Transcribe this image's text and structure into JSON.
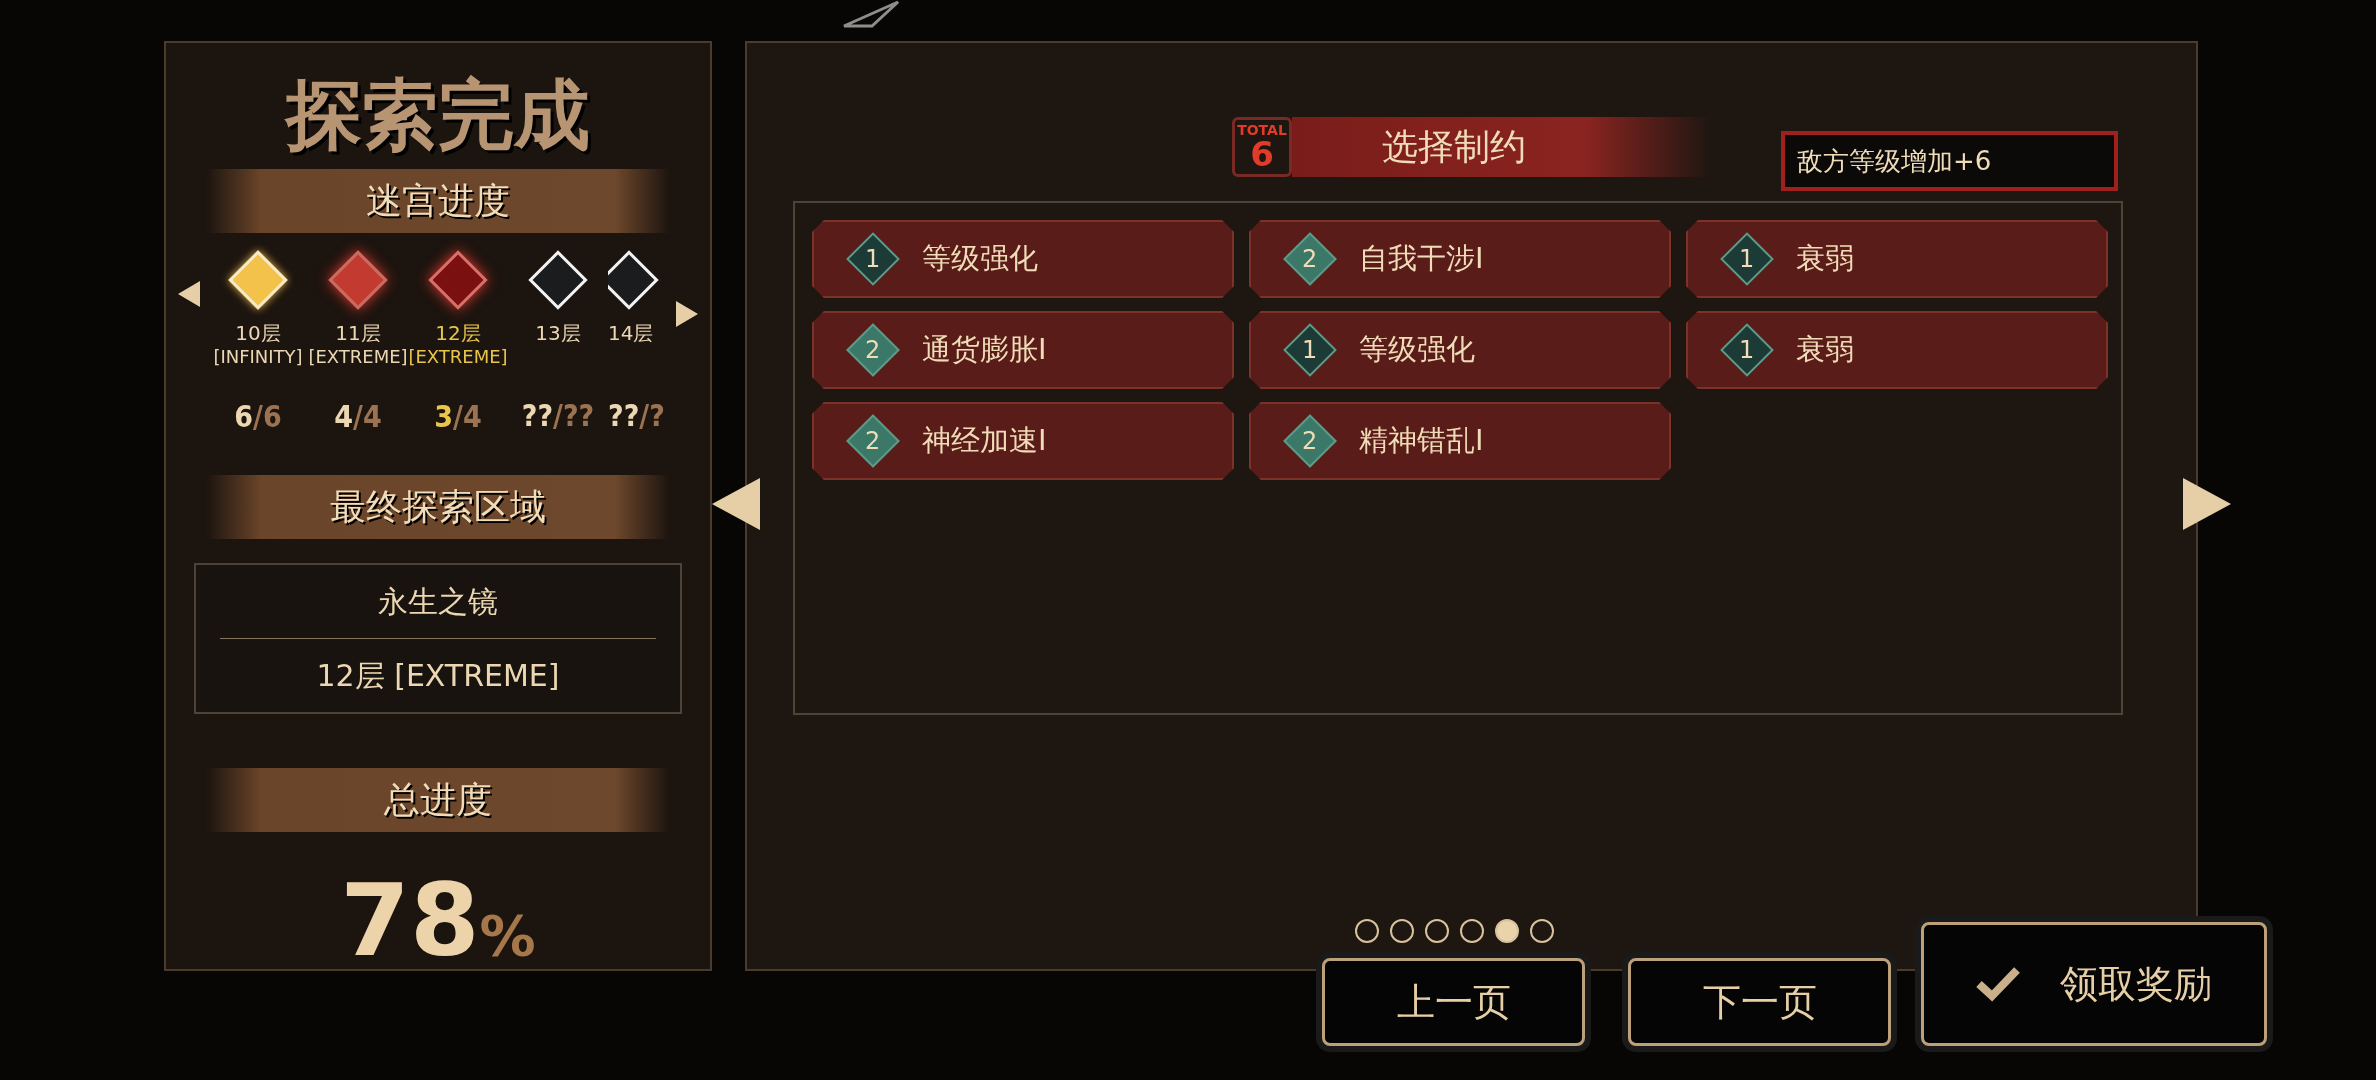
{
  "summary": {
    "title": "探索完成",
    "labyrinth": {
      "heading": "迷宫进度",
      "floors": [
        {
          "kind": "clear_gold",
          "label": "10层",
          "mode": "[INFINITY]",
          "count": "6/6",
          "selected": false
        },
        {
          "kind": "clear_red",
          "label": "11层",
          "mode": "[EXTREME]",
          "count": "4/4",
          "selected": false
        },
        {
          "kind": "red",
          "label": "12层",
          "mode": "[EXTREME]",
          "count": "3/4",
          "selected": true
        },
        {
          "kind": "locked",
          "label": "13层",
          "count": "??/??",
          "selected": false
        },
        {
          "kind": "locked",
          "label": "14层",
          "count": "??/?",
          "selected": false
        }
      ]
    },
    "final_area": {
      "heading": "最终探索区域",
      "name": "永生之镜",
      "floor": "12层 [EXTREME]"
    },
    "total": {
      "heading": "总进度",
      "value": "78",
      "unit": "%"
    }
  },
  "constraints": {
    "total_label": "TOTAL",
    "total": "6",
    "title": "选择制约",
    "effect": "敌方等级增加+6",
    "items": [
      {
        "cost": "1",
        "color": "#1d3b36",
        "name": "等级强化"
      },
      {
        "cost": "2",
        "color": "#3b7868",
        "name": "自我干涉I"
      },
      {
        "cost": "1",
        "color": "#1d3b36",
        "name": "衰弱"
      },
      {
        "cost": "2",
        "color": "#3b7868",
        "name": "通货膨胀I"
      },
      {
        "cost": "1",
        "color": "#1d3b36",
        "name": "等级强化"
      },
      {
        "cost": "1",
        "color": "#1d3b36",
        "name": "衰弱"
      },
      {
        "cost": "2",
        "color": "#3b7868",
        "name": "神经加速I"
      },
      {
        "cost": "2",
        "color": "#3b7868",
        "name": "精神错乱I"
      }
    ],
    "pages": [
      {
        "selected": false
      },
      {
        "selected": false
      },
      {
        "selected": false
      },
      {
        "selected": false
      },
      {
        "selected": true
      },
      {
        "selected": false
      }
    ]
  },
  "buttons": {
    "prev": "上一页",
    "next": "下一页",
    "claim": "领取奖励"
  }
}
